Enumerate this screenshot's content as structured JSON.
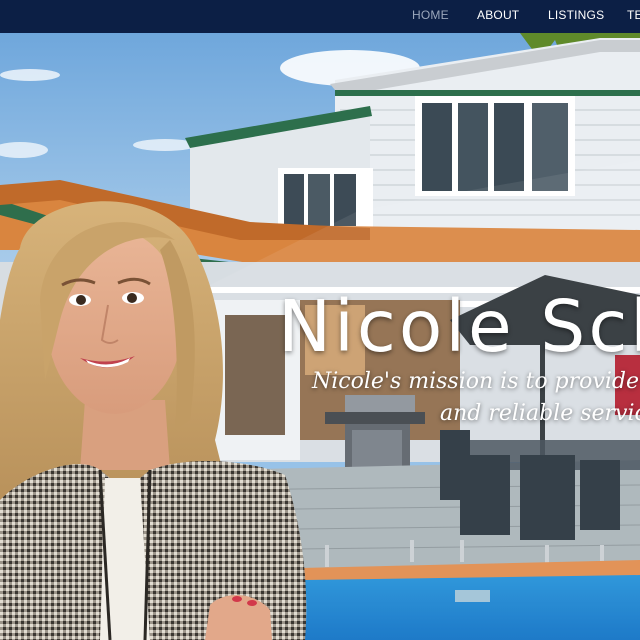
{
  "nav": {
    "items": [
      {
        "label": "HOME",
        "active": true
      },
      {
        "label": "ABOUT",
        "active": false
      },
      {
        "label": "LISTINGS",
        "active": false
      },
      {
        "label": "TE",
        "active": false
      }
    ]
  },
  "hero": {
    "title": "Nicole Sch",
    "subtitle_line1": "Nicole's mission is to provide a p",
    "subtitle_line2": "and reliable service"
  },
  "colors": {
    "nav_background": "#0c1f45",
    "nav_text": "#ffffff",
    "nav_active_text": "#9aa6bb"
  }
}
